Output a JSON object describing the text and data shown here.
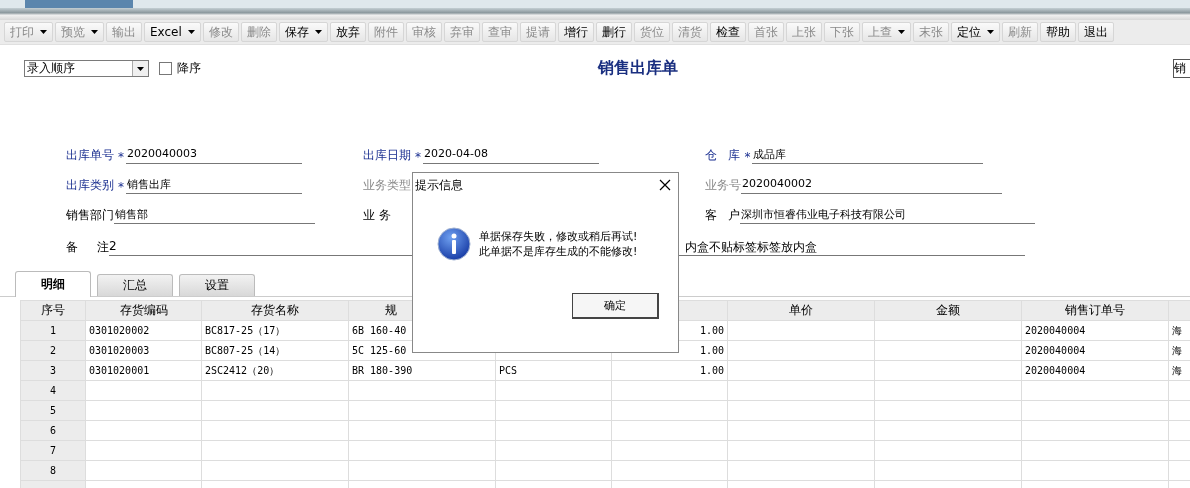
{
  "toolbar": [
    {
      "label": "打印",
      "kind": "dropdown",
      "disabled": true
    },
    {
      "label": "预览",
      "kind": "dropdown",
      "disabled": true
    },
    {
      "label": "输出",
      "kind": "plain",
      "disabled": true
    },
    {
      "label": "Excel",
      "kind": "dropdown",
      "disabled": false
    },
    {
      "label": "修改",
      "kind": "plain",
      "disabled": true
    },
    {
      "label": "删除",
      "kind": "plain",
      "disabled": true
    },
    {
      "label": "保存",
      "kind": "dropdown",
      "disabled": false
    },
    {
      "label": "放弃",
      "kind": "plain",
      "disabled": false
    },
    {
      "label": "附件",
      "kind": "plain",
      "disabled": true
    },
    {
      "label": "审核",
      "kind": "plain",
      "disabled": true
    },
    {
      "label": "弃审",
      "kind": "plain",
      "disabled": true
    },
    {
      "label": "查审",
      "kind": "plain",
      "disabled": true
    },
    {
      "label": "提请",
      "kind": "plain",
      "disabled": true
    },
    {
      "label": "增行",
      "kind": "plain",
      "disabled": false
    },
    {
      "label": "删行",
      "kind": "plain",
      "disabled": false
    },
    {
      "label": "货位",
      "kind": "plain",
      "disabled": true
    },
    {
      "label": "清货",
      "kind": "plain",
      "disabled": true
    },
    {
      "label": "检查",
      "kind": "plain",
      "disabled": false
    },
    {
      "label": "首张",
      "kind": "plain",
      "disabled": true
    },
    {
      "label": "上张",
      "kind": "plain",
      "disabled": true
    },
    {
      "label": "下张",
      "kind": "plain",
      "disabled": true
    },
    {
      "label": "上查",
      "kind": "dropdown",
      "disabled": true
    },
    {
      "label": "末张",
      "kind": "plain",
      "disabled": true
    },
    {
      "label": "定位",
      "kind": "dropdown",
      "disabled": false
    },
    {
      "label": "刷新",
      "kind": "plain",
      "disabled": true
    },
    {
      "label": "帮助",
      "kind": "plain",
      "disabled": false
    },
    {
      "label": "退出",
      "kind": "plain",
      "disabled": false
    }
  ],
  "sort": {
    "order": "录入顺序",
    "descending": {
      "label": "降序",
      "checked": false
    }
  },
  "title": "销售出库单",
  "right_field": {
    "value": "销"
  },
  "form": {
    "rows": [
      [
        {
          "label": "出库单号",
          "required": true,
          "disabled": false,
          "mark": "*",
          "value": "2020040003"
        },
        {
          "label": "出库日期",
          "required": true,
          "disabled": false,
          "mark": "*",
          "value": "2020-04-08"
        },
        {
          "label": "仓   库",
          "required": true,
          "disabled": false,
          "mark": "*",
          "value": "成品库"
        }
      ],
      [
        {
          "label": "出库类别",
          "required": true,
          "disabled": false,
          "mark": "*",
          "value": "销售出库"
        },
        {
          "label": "业务类型",
          "required": false,
          "disabled": true
        },
        {
          "label": "业务号",
          "required": false,
          "disabled": true,
          "value": "2020040002"
        }
      ],
      [
        {
          "label": "销售部门",
          "required": false,
          "disabled": false,
          "value": "销售部"
        },
        {
          "label": "业 务",
          "required": false,
          "disabled": false
        },
        {
          "label": "客   户",
          "required": false,
          "disabled": false,
          "value": "深圳市恒睿伟业电子科技有限公司"
        }
      ]
    ],
    "remark": {
      "label": "备     注",
      "value": "2",
      "value_tail": "内盒不贴标签标签放内盒"
    }
  },
  "tabs": [
    {
      "label": "明细",
      "selected": true
    },
    {
      "label": "汇总",
      "selected": false
    },
    {
      "label": "设置",
      "selected": false
    }
  ],
  "table": {
    "columns": [
      {
        "label": "序号"
      },
      {
        "label": "存货编码"
      },
      {
        "label": "存货名称"
      },
      {
        "label": "规"
      },
      {},
      {},
      {
        "label": "单价"
      },
      {
        "label": "金额"
      },
      {
        "label": "销售订单号"
      },
      {}
    ],
    "rows": [
      [
        "1",
        "0301020002",
        "BC817-25（17）",
        "6B 160-40",
        null,
        "1.00",
        null,
        null,
        "2020040004",
        "海"
      ],
      [
        "2",
        "0301020003",
        "BC807-25（14）",
        "5C 125-60",
        null,
        "1.00",
        null,
        null,
        "2020040004",
        "海"
      ],
      [
        "3",
        "0301020001",
        "2SC2412（20）",
        "BR 180-390",
        "PCS",
        "1.00",
        null,
        null,
        "2020040004",
        "海"
      ],
      [
        "4",
        null,
        null,
        null,
        null,
        null,
        null,
        null,
        null,
        null
      ],
      [
        "5",
        null,
        null,
        null,
        null,
        null,
        null,
        null,
        null,
        null
      ],
      [
        "6",
        null,
        null,
        null,
        null,
        null,
        null,
        null,
        null,
        null
      ],
      [
        "7",
        null,
        null,
        null,
        null,
        null,
        null,
        null,
        null,
        null
      ],
      [
        "8",
        null,
        null,
        null,
        null,
        null,
        null,
        null,
        null,
        null
      ]
    ]
  },
  "dialog": {
    "title": "提示信息",
    "messages": [
      "单据保存失败，修改或稍后再试!",
      "此单据不是库存生成的不能修改!"
    ],
    "button": "确定"
  }
}
